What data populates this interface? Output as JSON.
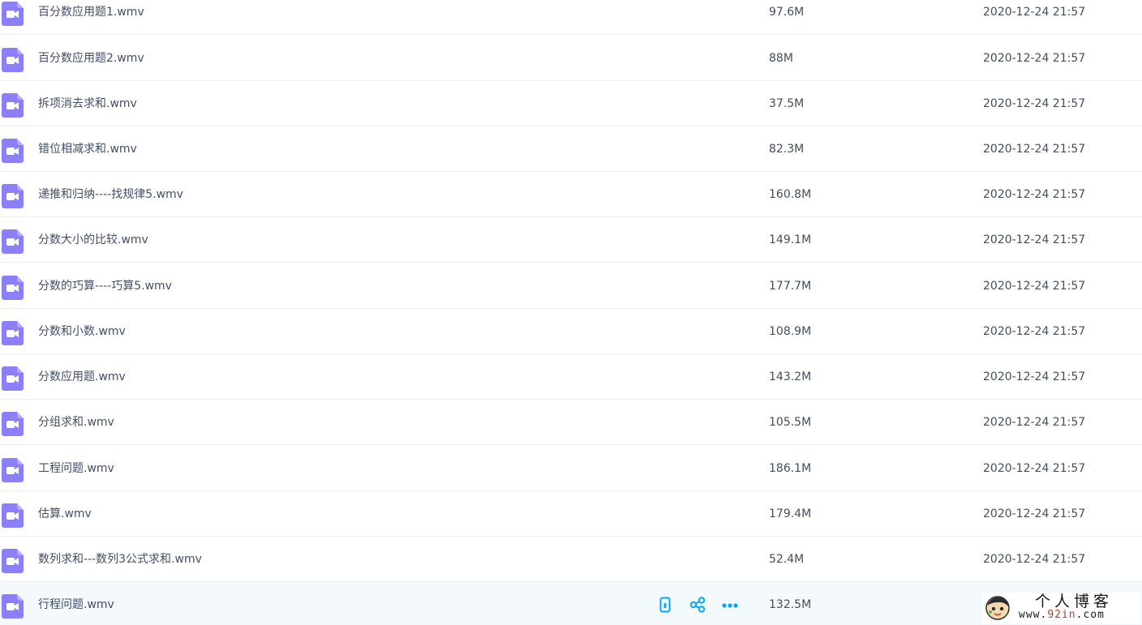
{
  "colors": {
    "video_icon": "#8b80f9",
    "action_icon": "#06a7ff",
    "hover_row": "#f4f9fe"
  },
  "files": [
    {
      "name": "百分数应用题1.wmv",
      "size": "97.6M",
      "date": "2020-12-24 21:57"
    },
    {
      "name": "百分数应用题2.wmv",
      "size": "88M",
      "date": "2020-12-24 21:57"
    },
    {
      "name": "拆项消去求和.wmv",
      "size": "37.5M",
      "date": "2020-12-24 21:57"
    },
    {
      "name": "错位相减求和.wmv",
      "size": "82.3M",
      "date": "2020-12-24 21:57"
    },
    {
      "name": "递推和归纳----找规律5.wmv",
      "size": "160.8M",
      "date": "2020-12-24 21:57"
    },
    {
      "name": "分数大小的比较.wmv",
      "size": "149.1M",
      "date": "2020-12-24 21:57"
    },
    {
      "name": "分数的巧算----巧算5.wmv",
      "size": "177.7M",
      "date": "2020-12-24 21:57"
    },
    {
      "name": "分数和小数.wmv",
      "size": "108.9M",
      "date": "2020-12-24 21:57"
    },
    {
      "name": "分数应用题.wmv",
      "size": "143.2M",
      "date": "2020-12-24 21:57"
    },
    {
      "name": "分组求和.wmv",
      "size": "105.5M",
      "date": "2020-12-24 21:57"
    },
    {
      "name": "工程问题.wmv",
      "size": "186.1M",
      "date": "2020-12-24 21:57"
    },
    {
      "name": "估算.wmv",
      "size": "179.4M",
      "date": "2020-12-24 21:57"
    },
    {
      "name": "数列求和---数列3公式求和.wmv",
      "size": "52.4M",
      "date": "2020-12-24 21:57"
    },
    {
      "name": "行程问题.wmv",
      "size": "132.5M",
      "date": ""
    }
  ],
  "hover_actions": [
    {
      "icon": "phone-icon"
    },
    {
      "icon": "share-icon"
    },
    {
      "icon": "more-icon"
    }
  ],
  "watermark": {
    "title": "个人博客",
    "url_prefix": "www.",
    "url_accent": "92in",
    "url_suffix": ".com"
  }
}
